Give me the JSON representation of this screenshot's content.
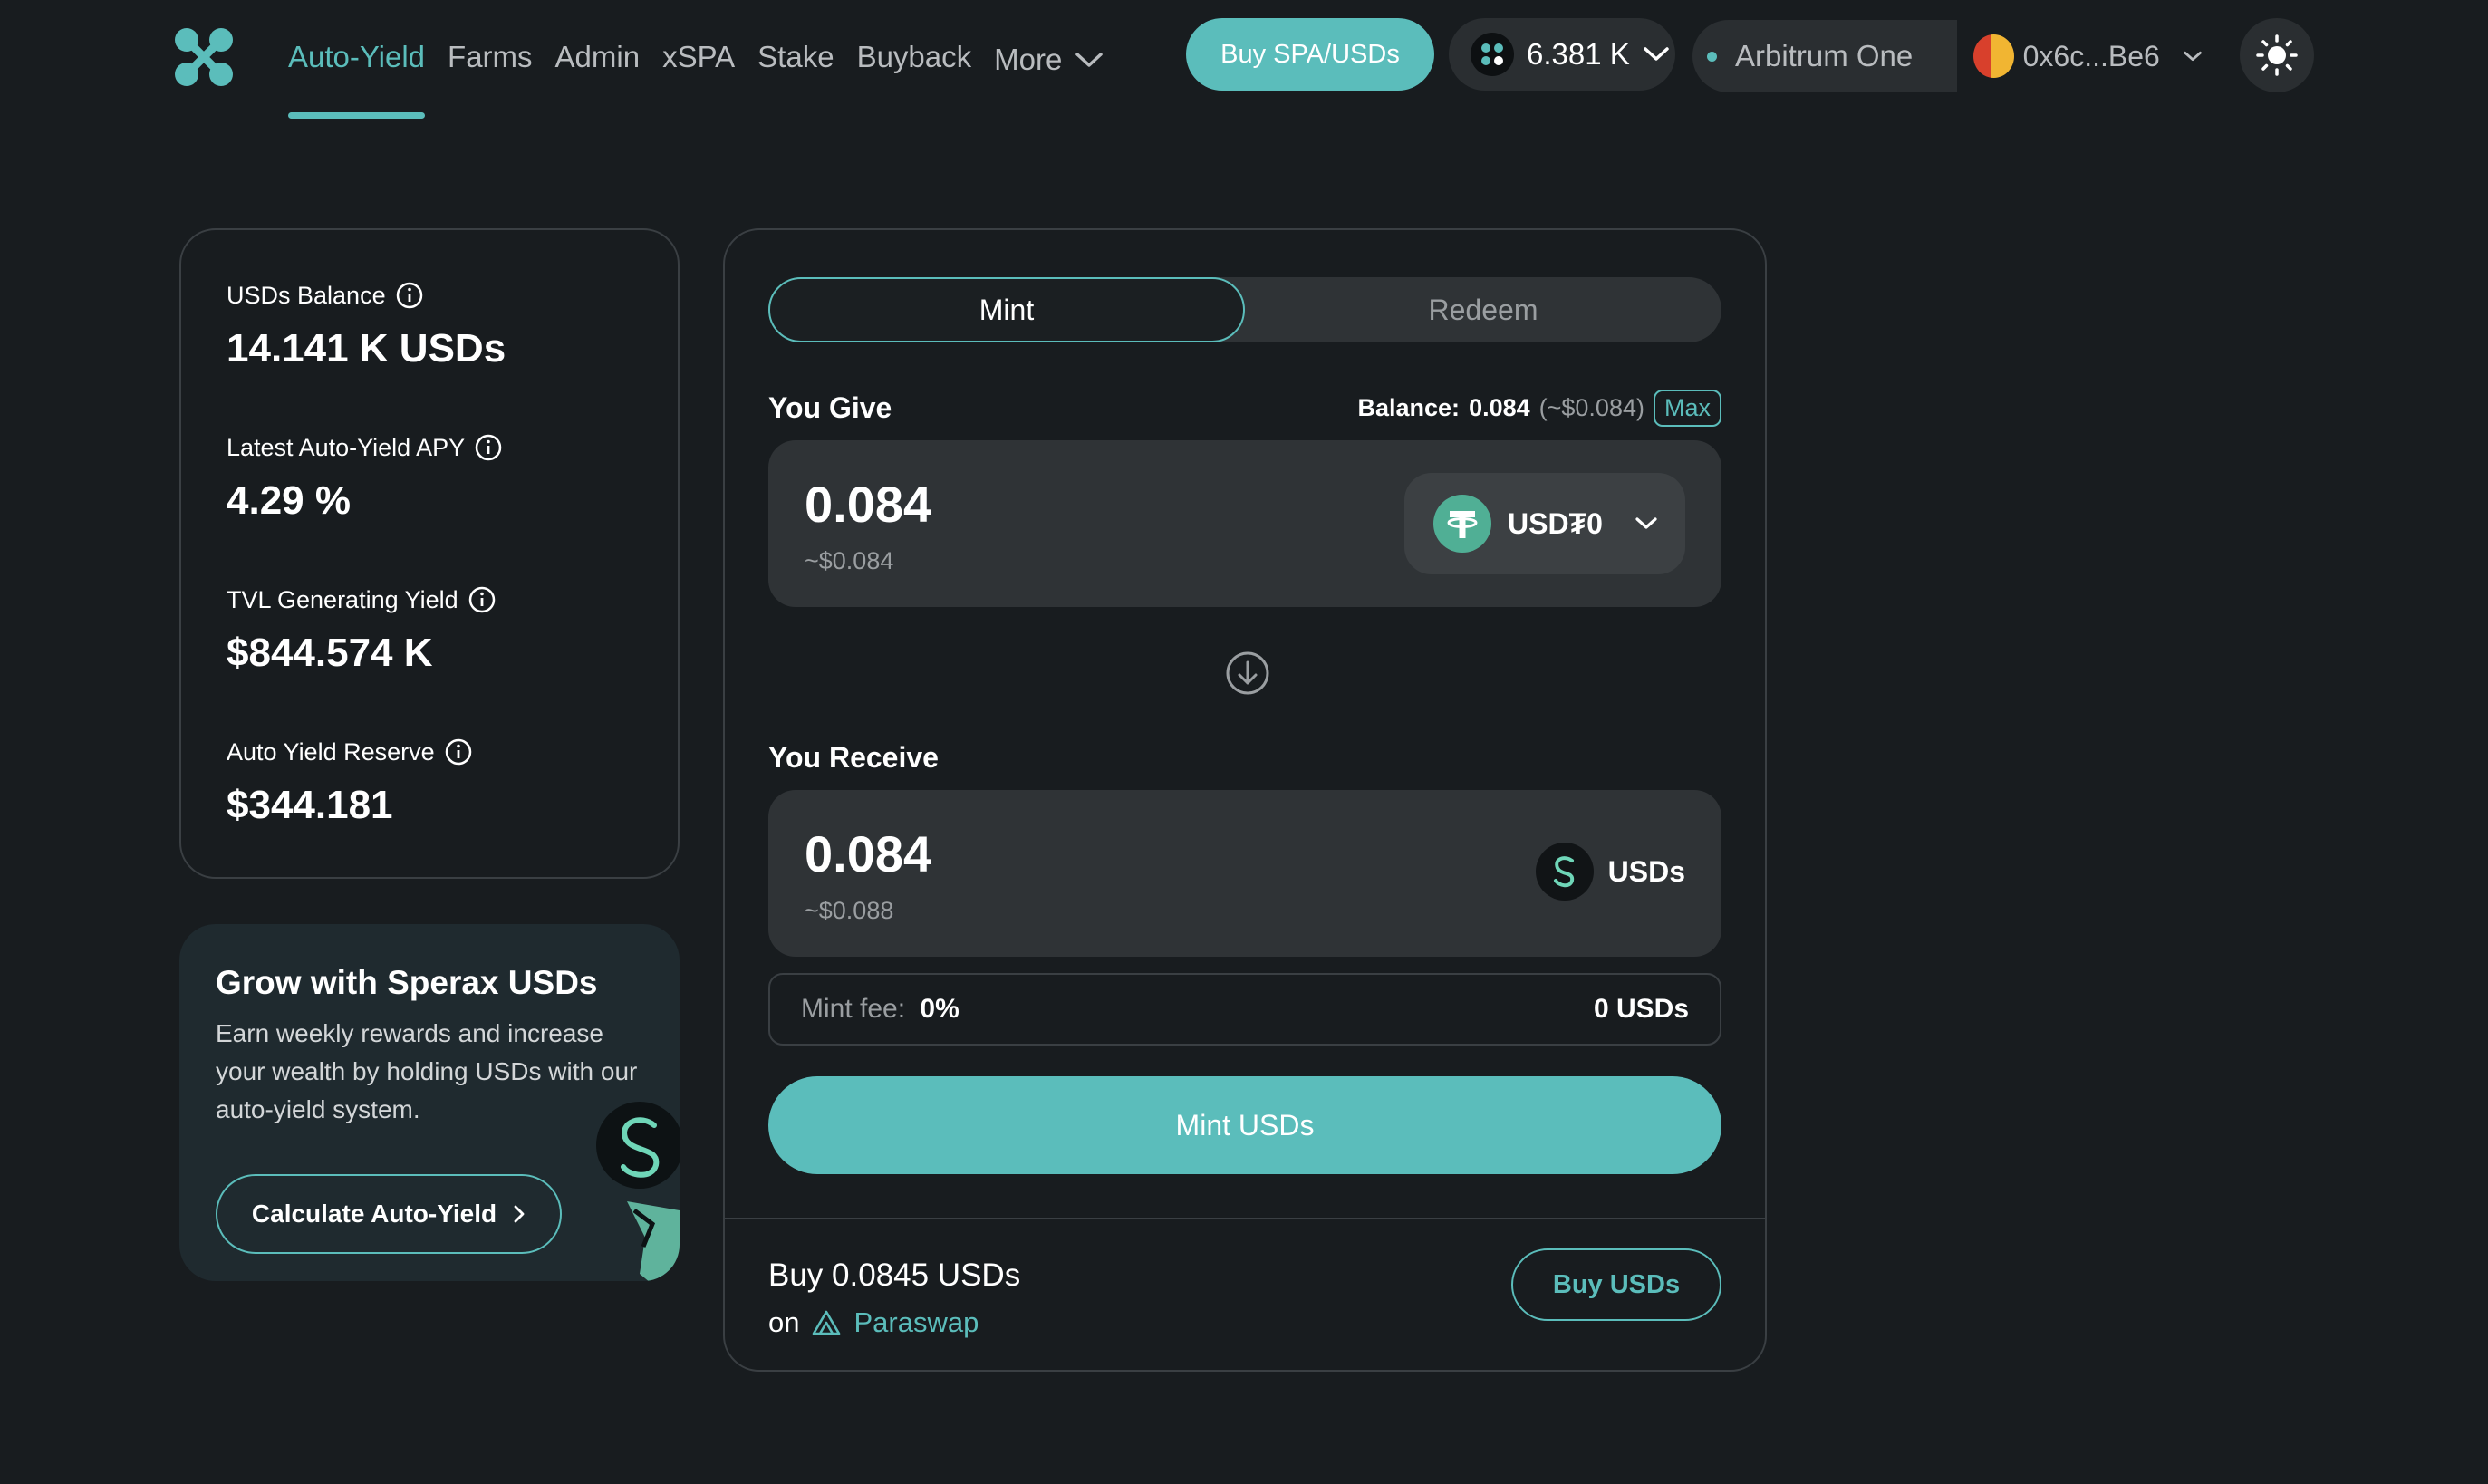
{
  "nav": {
    "items": [
      {
        "label": "Auto-Yield",
        "active": true
      },
      {
        "label": "Farms"
      },
      {
        "label": "Admin"
      },
      {
        "label": "xSPA"
      },
      {
        "label": "Stake"
      },
      {
        "label": "Buyback"
      }
    ],
    "more_label": "More"
  },
  "header": {
    "buy_button": "Buy SPA/USDs",
    "spa_balance": "6.381 K",
    "network": "Arbitrum One",
    "wallet_address": "0x6c...Be6"
  },
  "stats": [
    {
      "label": "USDs Balance",
      "value": "14.141 K USDs"
    },
    {
      "label": "Latest Auto-Yield APY",
      "value": "4.29 %"
    },
    {
      "label": "TVL Generating Yield",
      "value": "$844.574 K"
    },
    {
      "label": "Auto Yield Reserve",
      "value": "$344.181"
    }
  ],
  "promo": {
    "title": "Grow with Sperax USDs",
    "text": "Earn weekly rewards and increase your wealth by holding USDs with our auto-yield system.",
    "button": "Calculate Auto-Yield"
  },
  "swap": {
    "tabs": {
      "mint": "Mint",
      "redeem": "Redeem"
    },
    "give_label": "You Give",
    "balance_label": "Balance:",
    "balance_value": "0.084",
    "balance_usd": "(~$0.084)",
    "max_label": "Max",
    "give_amount": "0.084",
    "give_usd": "~$0.084",
    "give_token": "USD₮0",
    "receive_label": "You Receive",
    "receive_amount": "0.084",
    "receive_usd": "~$0.088",
    "receive_token": "USDs",
    "fee_label": "Mint fee:",
    "fee_value": "0%",
    "fee_amount": "0 USDs",
    "mint_button": "Mint USDs",
    "buy_text": "Buy 0.0845 USDs",
    "buy_on": "on",
    "buy_source": "Paraswap",
    "buy_button": "Buy USDs"
  },
  "colors": {
    "accent": "#5bbdbb",
    "background": "#181c1f",
    "card": "#2f3336",
    "usdt": "#50af95"
  }
}
